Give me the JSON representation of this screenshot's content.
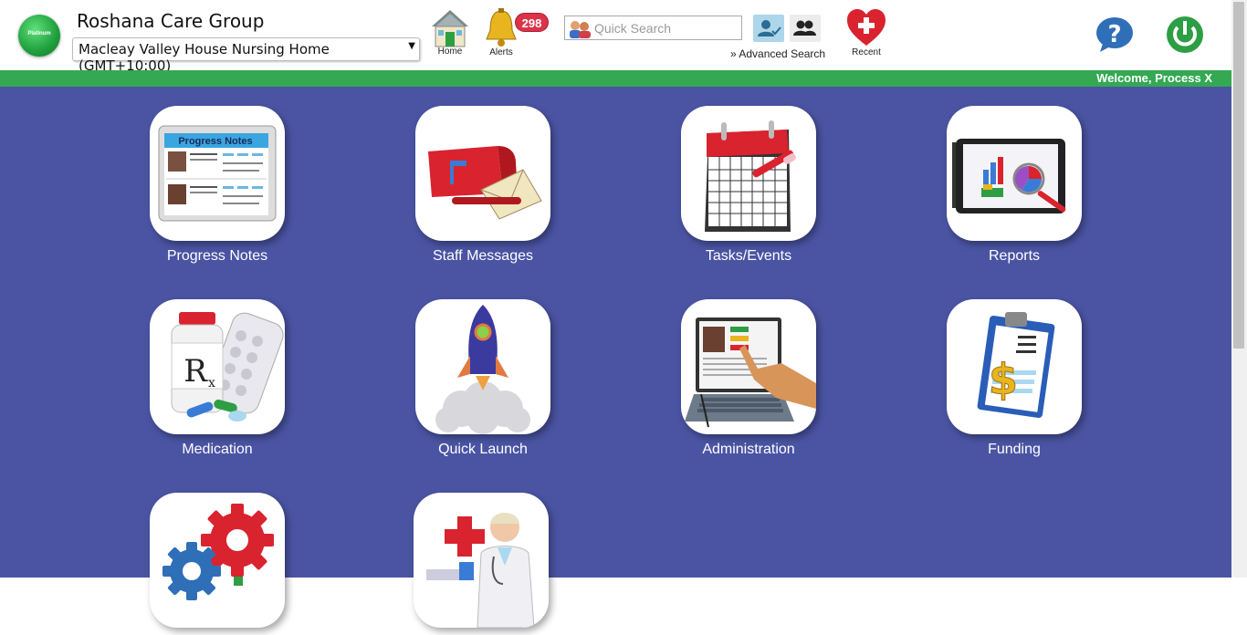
{
  "header": {
    "logo_text": "Platinum",
    "org_name": "Roshana Care Group",
    "facility": "Macleay Valley House Nursing Home (GMT+10:00)",
    "nav": [
      {
        "label": "Home",
        "icon": "home-icon"
      },
      {
        "label": "Alerts",
        "icon": "bell-icon",
        "badge": "298"
      },
      {
        "label": "Recent",
        "icon": "heart-icon"
      }
    ],
    "search": {
      "placeholder": "Quick Search",
      "advanced_label": "Advanced Search"
    },
    "help_icon": "help-icon",
    "power_icon": "power-icon"
  },
  "greenbar": {
    "welcome": "Welcome, Process X"
  },
  "tiles": [
    {
      "label": "Progress Notes",
      "icon": "progress-notes-icon",
      "inner_title": "Progress Notes"
    },
    {
      "label": "Staff Messages",
      "icon": "mailbox-icon"
    },
    {
      "label": "Tasks/Events",
      "icon": "calendar-icon"
    },
    {
      "label": "Reports",
      "icon": "reports-tablet-icon"
    },
    {
      "label": "Medication",
      "icon": "medication-icon"
    },
    {
      "label": "Quick Launch",
      "icon": "rocket-icon"
    },
    {
      "label": "Administration",
      "icon": "laptop-touch-icon"
    },
    {
      "label": "Funding",
      "icon": "clipboard-dollar-icon"
    },
    {
      "label": "",
      "icon": "gears-icon"
    },
    {
      "label": "",
      "icon": "doctor-icon"
    }
  ],
  "colors": {
    "main_bg": "#4a54a3",
    "green_bar": "#34a853",
    "badge": "#d9344a"
  }
}
